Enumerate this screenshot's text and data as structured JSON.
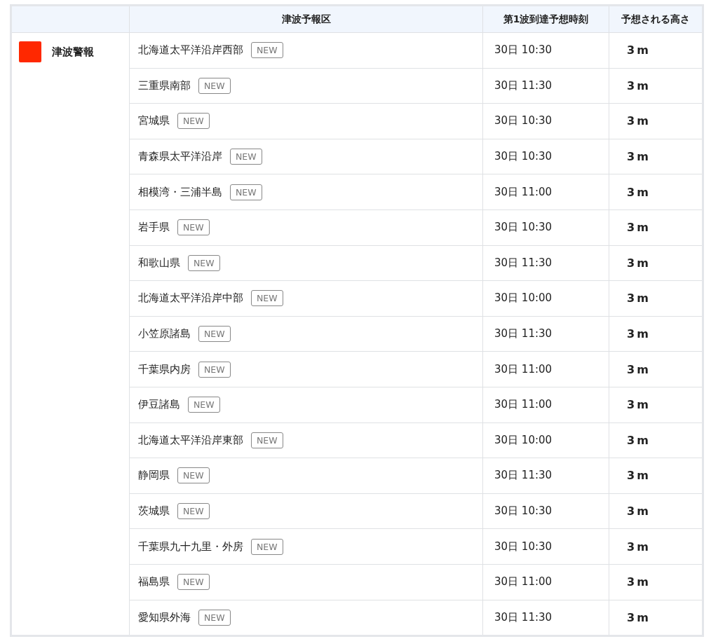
{
  "table": {
    "columns": [
      "津波予報区",
      "第1波到達予想時刻",
      "予想される高さ"
    ],
    "groups": [
      {
        "label": "津波警報",
        "color": "#ff2800",
        "rows": [
          {
            "area": "北海道太平洋沿岸西部",
            "badge": "NEW",
            "time": "30日 10:30",
            "height": "3m"
          },
          {
            "area": "三重県南部",
            "badge": "NEW",
            "time": "30日 11:30",
            "height": "3m"
          },
          {
            "area": "宮城県",
            "badge": "NEW",
            "time": "30日 10:30",
            "height": "3m"
          },
          {
            "area": "青森県太平洋沿岸",
            "badge": "NEW",
            "time": "30日 10:30",
            "height": "3m"
          },
          {
            "area": "相模湾・三浦半島",
            "badge": "NEW",
            "time": "30日 11:00",
            "height": "3m"
          },
          {
            "area": "岩手県",
            "badge": "NEW",
            "time": "30日 10:30",
            "height": "3m"
          },
          {
            "area": "和歌山県",
            "badge": "NEW",
            "time": "30日 11:30",
            "height": "3m"
          },
          {
            "area": "北海道太平洋沿岸中部",
            "badge": "NEW",
            "time": "30日 10:00",
            "height": "3m"
          },
          {
            "area": "小笠原諸島",
            "badge": "NEW",
            "time": "30日 11:30",
            "height": "3m"
          },
          {
            "area": "千葉県内房",
            "badge": "NEW",
            "time": "30日 11:00",
            "height": "3m"
          },
          {
            "area": "伊豆諸島",
            "badge": "NEW",
            "time": "30日 11:00",
            "height": "3m"
          },
          {
            "area": "北海道太平洋沿岸東部",
            "badge": "NEW",
            "time": "30日 10:00",
            "height": "3m"
          },
          {
            "area": "静岡県",
            "badge": "NEW",
            "time": "30日 11:30",
            "height": "3m"
          },
          {
            "area": "茨城県",
            "badge": "NEW",
            "time": "30日 10:30",
            "height": "3m"
          },
          {
            "area": "千葉県九十九里・外房",
            "badge": "NEW",
            "time": "30日 10:30",
            "height": "3m"
          },
          {
            "area": "福島県",
            "badge": "NEW",
            "time": "30日 11:00",
            "height": "3m"
          },
          {
            "area": "愛知県外海",
            "badge": "NEW",
            "time": "30日 11:30",
            "height": "3m"
          }
        ]
      }
    ]
  }
}
